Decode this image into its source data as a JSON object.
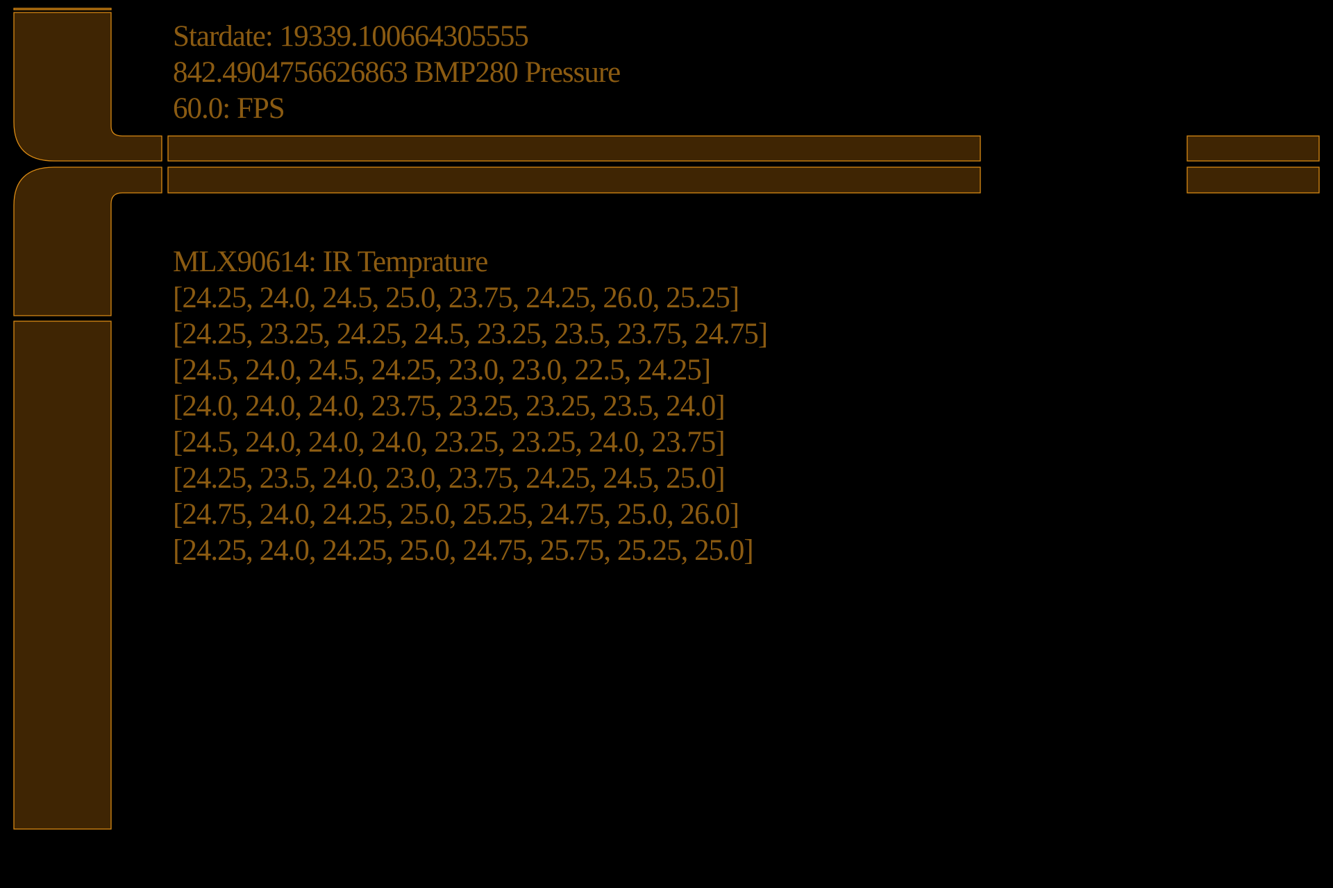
{
  "header": {
    "stardate": "Stardate: 19339.100664305555",
    "pressure": "842.4904756626863 BMP280 Pressure",
    "fps": "60.0: FPS"
  },
  "ir_sensor": {
    "title": "MLX90614: IR Temprature",
    "rows": [
      "[24.25, 24.0, 24.5, 25.0, 23.75, 24.25, 26.0, 25.25]",
      "[24.25, 23.25, 24.25, 24.5, 23.25, 23.5, 23.75, 24.75]",
      "[24.5, 24.0, 24.5, 24.25, 23.0, 23.0, 22.5, 24.25]",
      "[24.0, 24.0, 24.0, 23.75, 23.25, 23.25, 23.5, 24.0]",
      "[24.5, 24.0, 24.0, 24.0, 23.25, 23.25, 24.0, 23.75]",
      "[24.25, 23.5, 24.0, 23.0, 23.75, 24.25, 24.5, 25.0]",
      "[24.75, 24.0, 24.25, 25.0, 25.25, 24.75, 25.0, 26.0]",
      "[24.25, 24.0, 24.25, 25.0, 24.75, 25.75, 25.25, 25.0]"
    ]
  },
  "colors": {
    "background": "#000000",
    "panel_fill": "#3f2503",
    "panel_stroke": "#d98a14",
    "text": "#8b5b12"
  }
}
